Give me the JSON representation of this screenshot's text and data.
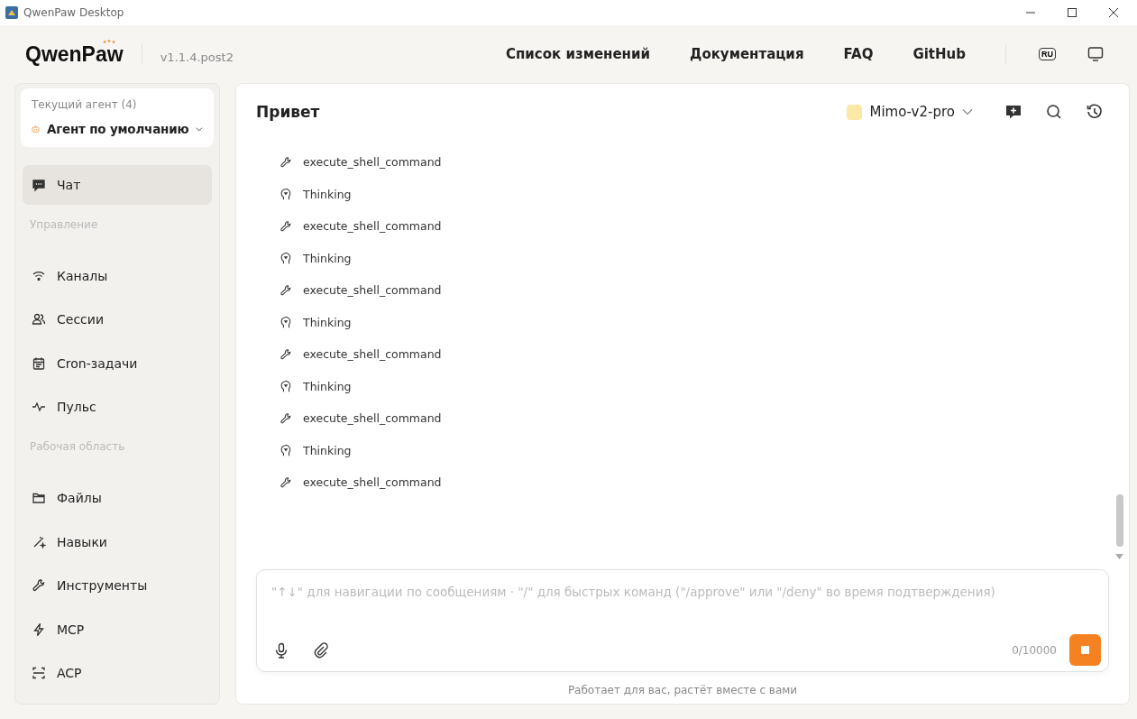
{
  "window": {
    "title": "QwenPaw Desktop"
  },
  "header": {
    "logo": "QwenPaw",
    "version": "v1.1.4.post2",
    "nav": [
      "Список изменений",
      "Документация",
      "FAQ",
      "GitHub"
    ],
    "language": "RU"
  },
  "sidebar": {
    "agent": {
      "label": "Текущий агент (4)",
      "name": "Агент по умолчанию"
    },
    "items": [
      {
        "kind": "item",
        "label": "Чат",
        "selected": true
      },
      {
        "kind": "section",
        "label": "Управление"
      },
      {
        "kind": "item",
        "label": "Каналы",
        "selected": false
      },
      {
        "kind": "item",
        "label": "Сессии",
        "selected": false
      },
      {
        "kind": "item",
        "label": "Cron-задачи",
        "selected": false
      },
      {
        "kind": "item",
        "label": "Пульс",
        "selected": false
      },
      {
        "kind": "section",
        "label": "Рабочая область"
      },
      {
        "kind": "item",
        "label": "Файлы",
        "selected": false
      },
      {
        "kind": "item",
        "label": "Навыки",
        "selected": false
      },
      {
        "kind": "item",
        "label": "Инструменты",
        "selected": false
      },
      {
        "kind": "item",
        "label": "MCP",
        "selected": false
      },
      {
        "kind": "item",
        "label": "ACP",
        "selected": false
      }
    ]
  },
  "chat": {
    "title": "Привет",
    "model": "Mimo-v2-pro",
    "messages": [
      {
        "kind": "tool",
        "label": "execute_shell_command"
      },
      {
        "kind": "thinking",
        "label": "Thinking"
      },
      {
        "kind": "tool",
        "label": "execute_shell_command"
      },
      {
        "kind": "thinking",
        "label": "Thinking"
      },
      {
        "kind": "tool",
        "label": "execute_shell_command"
      },
      {
        "kind": "thinking",
        "label": "Thinking"
      },
      {
        "kind": "tool",
        "label": "execute_shell_command"
      },
      {
        "kind": "thinking",
        "label": "Thinking"
      },
      {
        "kind": "tool",
        "label": "execute_shell_command"
      },
      {
        "kind": "thinking",
        "label": "Thinking"
      },
      {
        "kind": "tool",
        "label": "execute_shell_command"
      }
    ],
    "placeholder": "\"↑↓\" для навигации по сообщениям · \"/\" для быстрых команд (\"/approve\" или \"/deny\" во время подтверждения)",
    "counter": "0/10000",
    "footer": "Работает для вас, растёт вместе с вами"
  }
}
